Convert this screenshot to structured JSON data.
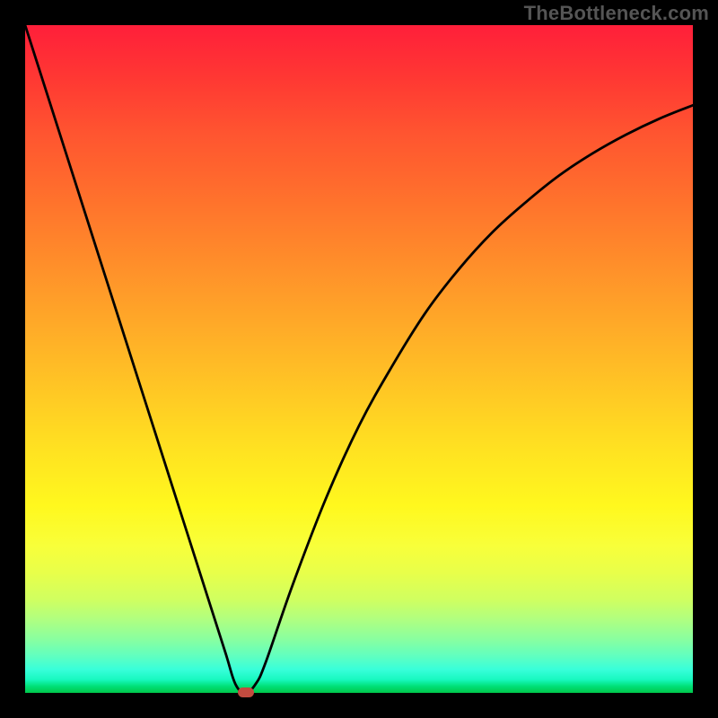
{
  "watermark": "TheBottleneck.com",
  "colors": {
    "marker": "#c24b3f"
  },
  "chart_data": {
    "type": "line",
    "title": "",
    "xlabel": "",
    "ylabel": "",
    "xlim": [
      0,
      100
    ],
    "ylim": [
      0,
      100
    ],
    "grid": false,
    "x": [
      0,
      3,
      6,
      9,
      12,
      15,
      18,
      21,
      24,
      27,
      30,
      31.5,
      33,
      34.5,
      36,
      40,
      45,
      50,
      55,
      60,
      65,
      70,
      75,
      80,
      85,
      90,
      95,
      100
    ],
    "y": [
      100,
      90.6,
      81.2,
      71.8,
      62.4,
      53.0,
      43.6,
      34.2,
      24.8,
      15.4,
      6.0,
      1.3,
      0.0,
      1.3,
      4.5,
      16.0,
      29.0,
      40.0,
      49.0,
      57.0,
      63.5,
      69.0,
      73.5,
      77.5,
      80.8,
      83.6,
      86.0,
      88.0
    ],
    "annotations": [
      {
        "type": "marker",
        "x": 33,
        "y": 0
      }
    ]
  }
}
